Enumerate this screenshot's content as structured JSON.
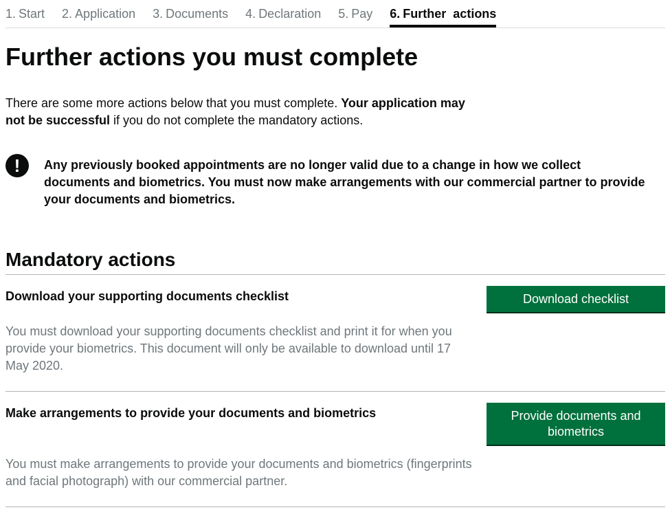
{
  "steps": [
    {
      "num": "1.",
      "label": "Start"
    },
    {
      "num": "2.",
      "label": "Application"
    },
    {
      "num": "3.",
      "label": "Documents"
    },
    {
      "num": "4.",
      "label": "Declaration"
    },
    {
      "num": "5.",
      "label": "Pay"
    },
    {
      "num": "6.",
      "label": "Further  actions"
    }
  ],
  "page_title": "Further actions you must complete",
  "intro": {
    "text_start": "There are some more actions below that you must complete. ",
    "bold": "Your application may not be successful",
    "text_end": " if you do not complete the mandatory actions."
  },
  "warning": {
    "icon": "!",
    "text": "Any previously booked appointments are no longer valid due to a change in how we collect documents and biometrics. You must now make arrangements with our commercial partner to provide your documents and biometrics."
  },
  "section_title": "Mandatory actions",
  "actions": [
    {
      "title": "Download your supporting documents checklist",
      "description": "You must download your supporting documents checklist and print it for when you provide your biometrics. This document will only be available to download until 17 May 2020.",
      "button": "Download checklist"
    },
    {
      "title": "Make arrangements to provide your documents and biometrics",
      "description": "You must make arrangements to provide your documents and biometrics (fingerprints and facial photograph) with our commercial partner.",
      "button": "Provide documents and biometrics"
    }
  ],
  "colors": {
    "primary_button": "#00703c",
    "text": "#0b0c0c",
    "secondary_text": "#6f777b"
  }
}
